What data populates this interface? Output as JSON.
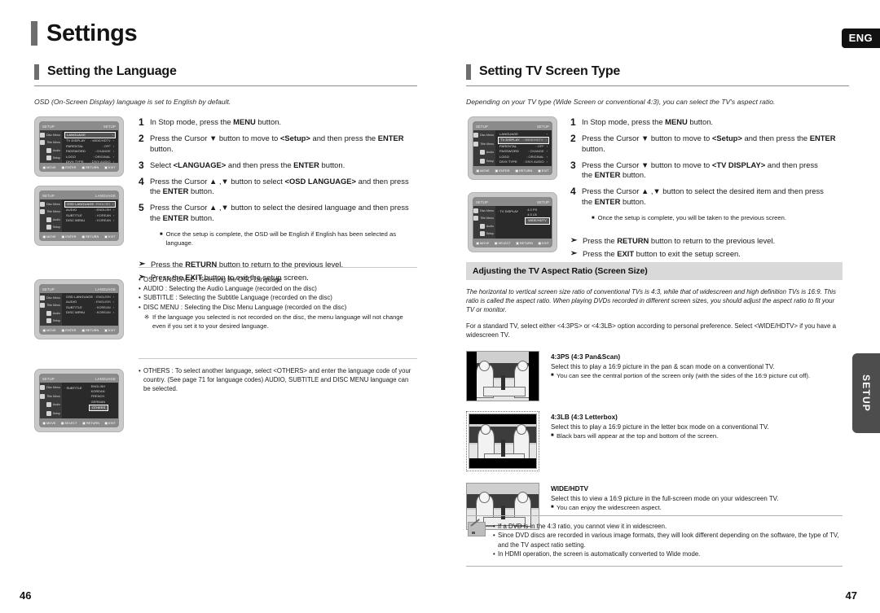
{
  "header": {
    "title": "Settings",
    "language_tab": "ENG",
    "side_tab": "SETUP"
  },
  "footer": {
    "page_left": "46",
    "page_right": "47"
  },
  "left_column": {
    "section_title": "Setting the Language",
    "intro": "OSD  (On-Screen Display) language is set to English by default.",
    "steps": [
      {
        "num": "1",
        "text": "In Stop mode, press the <b>MENU</b> button."
      },
      {
        "num": "2",
        "text": "Press the Cursor ▼ button to move to <b>&lt;Setup&gt;</b> and then press the <b>ENTER</b> button."
      },
      {
        "num": "3",
        "text": "Select <b>&lt;LANGUAGE&gt;</b> and then press the <b>ENTER</b> button."
      },
      {
        "num": "4",
        "text": "Press the Cursor ▲ ,▼ button to select <b>&lt;OSD LANGUAGE&gt;</b> and then press<br>the <b>ENTER</b> button."
      },
      {
        "num": "5",
        "text": "Press the Cursor ▲ ,▼ button to select the desired language and then press<br>the <b>ENTER</b> button."
      }
    ],
    "step5_note": "Once the setup is complete, the OSD will be English if English has been selected as language.",
    "arrows": [
      "Press the <b>RETURN</b> button to return to the previous level.",
      "Press the <b>EXIT</b> button to exit the setup screen."
    ],
    "definitions": [
      "OSD LANGUAGE : Selecting the OSD Language",
      "AUDIO : Selecting the Audio Language (recorded on the disc)",
      "SUBTITLE : Selecting the Subtitle Language (recorded on the disc)",
      "DISC MENU : Selecting the Disc Menu Language (recorded on the disc)"
    ],
    "star_note": "If the language you selected is not recorded on the disc, the menu language will not change even if you set it to your desired language.",
    "others_label": "OTHERS :",
    "others_text": "To select another language, select &lt;OTHERS&gt; and enter the language code of your country. (See page 71 for language codes) AUDIO, SUBTITLE and DISC MENU language can be selected.",
    "osd_screens": [
      {
        "name": "setup-menu",
        "top_left": "SETUP",
        "top_right": "SETUP",
        "rail": [
          "Disc Menu",
          "Title Menu",
          "Audio",
          "Setup"
        ],
        "rows": [
          {
            "label": "LANGUAGE",
            "value": "",
            "selected": true
          },
          {
            "label": "TV DISPLAY",
            "value": "WIDE/HDTV",
            "selected": false
          },
          {
            "label": "PARENTAL",
            "value": "OFF",
            "selected": false
          },
          {
            "label": "PASSWORD",
            "value": "CHANGE",
            "selected": false
          },
          {
            "label": "LOGO",
            "value": "ORIGINAL",
            "selected": false
          },
          {
            "label": "DIVX TYPE",
            "value": "DIVX AUDIO",
            "selected": false
          }
        ],
        "bottom": [
          "MOVE",
          "ENTER",
          "RETURN",
          "EXIT"
        ]
      },
      {
        "name": "language-menu",
        "top_left": "SETUP",
        "top_right": "LANGUAGE",
        "rail": [
          "Disc Menu",
          "Title Menu",
          "Audio",
          "Setup"
        ],
        "rows": [
          {
            "label": "OSD LANGUAGE",
            "value": "ENGLISH",
            "selected": true
          },
          {
            "label": "AUDIO",
            "value": "ENGLISH",
            "selected": false
          },
          {
            "label": "SUBTITLE",
            "value": "KOREAN",
            "selected": false
          },
          {
            "label": "DISC MENU",
            "value": "KOREAN",
            "selected": false
          }
        ],
        "bottom": [
          "MOVE",
          "ENTER",
          "RETURN",
          "EXIT"
        ]
      },
      {
        "name": "language-menu-english",
        "top_left": "SETUP",
        "top_right": "LANGUAGE",
        "rail": [
          "Disc Menu",
          "Title Menu",
          "Audio",
          "Setup"
        ],
        "rows": [
          {
            "label": "OSD LANGUAGE",
            "value": "ENGLISH",
            "selected": false
          },
          {
            "label": "AUDIO",
            "value": "ENGLISH",
            "selected": false
          },
          {
            "label": "SUBTITLE",
            "value": "KOREAN",
            "selected": false
          },
          {
            "label": "DISC MENU",
            "value": "KOREAN",
            "selected": false
          }
        ],
        "bottom": [
          "MOVE",
          "ENTER",
          "RETURN",
          "EXIT"
        ]
      },
      {
        "name": "subtitle-language-list",
        "top_left": "SETUP",
        "top_right": "LANGUAGE",
        "rail": [
          "Disc Menu",
          "Title Menu",
          "Audio",
          "Setup"
        ],
        "panel_label": "SUBTITLE",
        "options": [
          {
            "label": "ENGLISH",
            "selected": false
          },
          {
            "label": "KOREAN",
            "selected": false
          },
          {
            "label": "FRENCH",
            "selected": false
          },
          {
            "label": "GERMAN",
            "selected": false
          },
          {
            "label": "OTHERS",
            "selected": true
          }
        ],
        "bottom": [
          "MOVE",
          "SELECT",
          "RETURN",
          "EXIT"
        ]
      }
    ]
  },
  "right_column": {
    "section_title": "Setting TV Screen Type",
    "intro": "Depending on your TV type (Wide Screen or conventional 4:3), you can select the TV's aspect ratio.",
    "steps": [
      {
        "num": "1",
        "text": "In Stop mode, press the <b>MENU</b> button."
      },
      {
        "num": "2",
        "text": "Press the Cursor ▼ button to move to <b>&lt;Setup&gt;</b> and then press the <b>ENTER</b> button."
      },
      {
        "num": "3",
        "text": "Press the Cursor ▼ button to move to <b>&lt;TV DISPLAY&gt;</b> and then press<br>the <b>ENTER</b> button."
      },
      {
        "num": "4",
        "text": "Press the Cursor ▲ ,▼ button to select the desired item and then press<br>the <b>ENTER</b> button."
      }
    ],
    "step4_note": "Once the setup is complete, you will be taken to the previous screen.",
    "arrows": [
      "Press the <b>RETURN</b> button to return to the previous level.",
      "Press the <b>EXIT</b> button to exit the setup screen."
    ],
    "band_title": "Adjusting the TV Aspect Ratio (Screen Size)",
    "band_italic": "The horizontal to vertical screen size ratio of conventional TVs is 4:3, while that of widescreen and high definition TVs is 16:9. This ratio is called the aspect ratio. When playing DVDs recorded in different screen sizes, you should adjust the aspect ratio to fit your TV or monitor.",
    "band_plain": "For a standard TV, select either &lt;4:3PS&gt; or &lt;4:3LB&gt; option according to personal preference. Select &lt;WIDE/HDTV&gt; if you have a widescreen TV.",
    "aspect_items": [
      {
        "mode": "pan-scan",
        "title": "4:3PS (4:3 Pan&Scan)",
        "desc": "Select this to play a 16:9 picture in the pan & scan mode on a conventional TV.",
        "bullet": "You can see the central portion of the screen only (with the sides of the 16:9 picture cut off)."
      },
      {
        "mode": "letterbox",
        "title": "4:3LB (4:3 Letterbox)",
        "desc": "Select this to play a 16:9 picture in the letter box mode on a conventional TV.",
        "bullet": "Black bars will appear at the top and bottom of the screen."
      },
      {
        "mode": "wide-hdtv",
        "title": "WIDE/HDTV",
        "desc": "Select this to view a 16:9 picture in the full-screen mode on your widescreen TV.",
        "bullet": "You can enjoy the widescreen aspect."
      }
    ],
    "notes": [
      "If a DVD is in the 4:3 ratio, you cannot view it in widescreen.",
      "Since DVD discs are recorded in various image formats, they will look different depending on the software, the type of TV, and the TV aspect ratio setting.",
      "In HDMI operation, the screen is automatically converted to Wide mode."
    ],
    "osd_screens": [
      {
        "name": "setup-menu-tvdisplay",
        "top_left": "SETUP",
        "top_right": "SETUP",
        "rail": [
          "Disc Menu",
          "Title Menu",
          "Audio",
          "Setup"
        ],
        "rows": [
          {
            "label": "LANGUAGE",
            "value": "",
            "selected": false
          },
          {
            "label": "TV DISPLAY",
            "value": "WIDE/HDTV",
            "selected": true
          },
          {
            "label": "PARENTAL",
            "value": "OFF",
            "selected": false
          },
          {
            "label": "PASSWORD",
            "value": "CHANGE",
            "selected": false
          },
          {
            "label": "LOGO",
            "value": "ORIGINAL",
            "selected": false
          },
          {
            "label": "DIVX TYPE",
            "value": "DIVX AUDIO",
            "selected": false
          }
        ],
        "bottom": [
          "MOVE",
          "ENTER",
          "RETURN",
          "EXIT"
        ]
      },
      {
        "name": "tv-display-options",
        "top_left": "SETUP",
        "top_right": "SETUP",
        "rail": [
          "Disc Menu",
          "Title Menu",
          "Audio",
          "Setup"
        ],
        "panel_label": "TV DISPLAY",
        "options": [
          {
            "label": "4:3 PS",
            "selected": false
          },
          {
            "label": "4:3 LB",
            "selected": false
          },
          {
            "label": "WIDE/HDTV",
            "selected": true
          }
        ],
        "bottom": [
          "MOVE",
          "SELECT",
          "RETURN",
          "EXIT"
        ]
      }
    ]
  }
}
